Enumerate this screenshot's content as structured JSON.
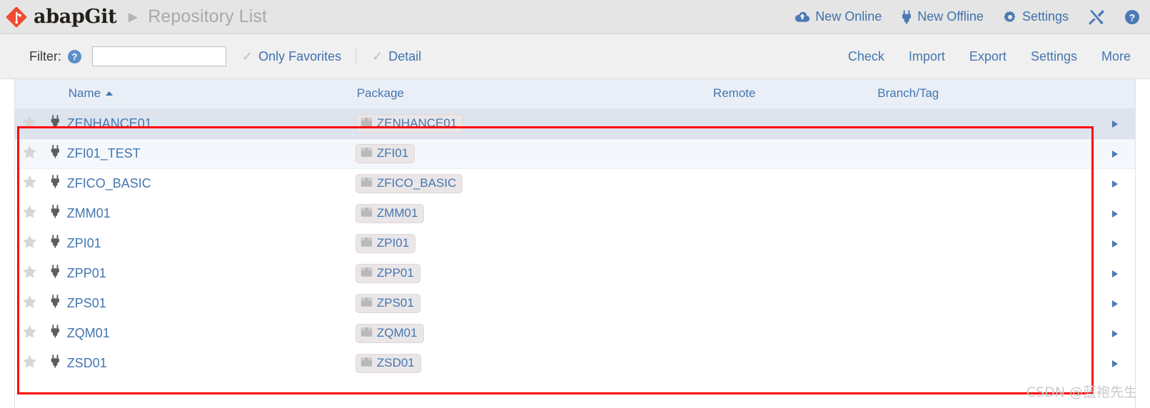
{
  "header": {
    "logo_icon": "git-diamond-logo",
    "brand": "abapGit",
    "separator_icon": "play-triangle-icon",
    "page_title": "Repository List",
    "actions": [
      {
        "label": "New Online",
        "icon": "cloud-upload-icon"
      },
      {
        "label": "New Offline",
        "icon": "plug-icon"
      },
      {
        "label": "Settings",
        "icon": "gear-icon"
      },
      {
        "label": "",
        "icon": "tools-icon"
      },
      {
        "label": "",
        "icon": "help-circle-icon"
      }
    ]
  },
  "filterbar": {
    "filter_label": "Filter:",
    "help_icon": "help-circle-icon",
    "help_glyph": "?",
    "filter_value": "",
    "filter_placeholder": "",
    "checkboxes": [
      {
        "label": "Only Favorites",
        "icon": "check-icon",
        "checked": true
      },
      {
        "label": "Detail",
        "icon": "check-icon",
        "checked": true
      }
    ],
    "right_links": [
      "Check",
      "Import",
      "Export",
      "Settings",
      "More"
    ]
  },
  "table": {
    "columns": [
      "",
      "",
      "Name",
      "Package",
      "Remote",
      "Branch/Tag",
      ""
    ],
    "sort_column": "Name",
    "sort_direction": "asc",
    "headers": {
      "name": "Name",
      "package": "Package",
      "remote": "Remote",
      "branch": "Branch/Tag"
    },
    "row_icons": {
      "favorite": "star-icon",
      "type": "plug-icon",
      "package": "package-box-icon",
      "expand": "caret-right-icon"
    },
    "rows": [
      {
        "name": "ZENHANCE01",
        "package": "ZENHANCE01",
        "remote": "",
        "branch": "",
        "style": "r-hl"
      },
      {
        "name": "ZFI01_TEST",
        "package": "ZFI01",
        "remote": "",
        "branch": "",
        "style": "r-alt"
      },
      {
        "name": "ZFICO_BASIC",
        "package": "ZFICO_BASIC",
        "remote": "",
        "branch": "",
        "style": "r-plain"
      },
      {
        "name": "ZMM01",
        "package": "ZMM01",
        "remote": "",
        "branch": "",
        "style": "r-plain"
      },
      {
        "name": "ZPI01",
        "package": "ZPI01",
        "remote": "",
        "branch": "",
        "style": "r-plain"
      },
      {
        "name": "ZPP01",
        "package": "ZPP01",
        "remote": "",
        "branch": "",
        "style": "r-plain"
      },
      {
        "name": "ZPS01",
        "package": "ZPS01",
        "remote": "",
        "branch": "",
        "style": "r-plain"
      },
      {
        "name": "ZQM01",
        "package": "ZQM01",
        "remote": "",
        "branch": "",
        "style": "r-plain"
      },
      {
        "name": "ZSD01",
        "package": "ZSD01",
        "remote": "",
        "branch": "",
        "style": "r-plain"
      }
    ]
  },
  "watermark": "CSDN @蓝袍先生",
  "colors": {
    "link_blue": "#4476b0",
    "header_bg": "#e5e5e5",
    "filter_bg": "#f0f0f0",
    "table_header_bg": "#eaeff7",
    "row_highlight": "#dde4ee",
    "row_alt": "#f4f8fc",
    "logo_red": "#ef4b32",
    "annotation_red": "#fb0a06"
  }
}
